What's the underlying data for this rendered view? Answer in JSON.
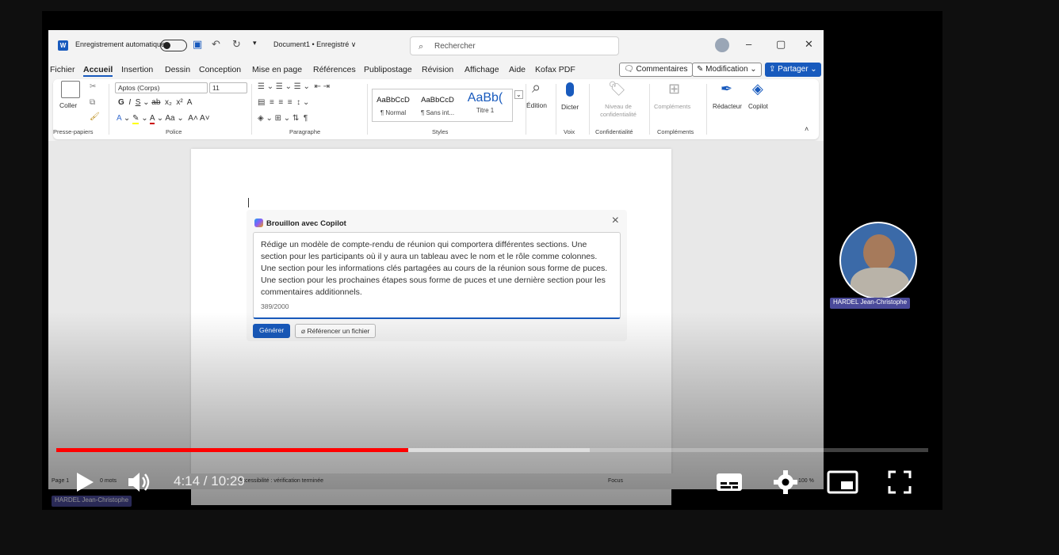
{
  "word": {
    "titlebar": {
      "autosave_label": "Enregistrement automatique",
      "doc_title": "Document1 • Enregistré ∨",
      "search_placeholder": "Rechercher"
    },
    "menu": {
      "tabs": [
        "Fichier",
        "Accueil",
        "Insertion",
        "Dessin",
        "Conception",
        "Mise en page",
        "Références",
        "Publipostage",
        "Révision",
        "Affichage",
        "Aide",
        "Kofax PDF"
      ],
      "active_tab": "Accueil",
      "comments_button": "Commentaires",
      "editing_button": "Modification",
      "share_button": "Partager"
    },
    "ribbon": {
      "paste_label": "Coller",
      "font_name": "Aptos (Corps)",
      "font_size": "11",
      "styles": [
        {
          "preview": "AaBbCcD",
          "name": "¶ Normal"
        },
        {
          "preview": "AaBbCcD",
          "name": "¶ Sans int..."
        },
        {
          "preview": "AaBb(",
          "name": "Titre 1"
        }
      ],
      "edition_label": "Édition",
      "dictate_label": "Dicter",
      "sensitivity_label": "Niveau de confidentialité",
      "addins_label": "Compléments",
      "editor_label": "Rédacteur",
      "copilot_label": "Copilot",
      "groups": {
        "clipboard": "Presse-papiers",
        "font": "Police",
        "paragraph": "Paragraphe",
        "styles": "Styles",
        "voice": "Voix",
        "sensitivity": "Confidentialité",
        "addins": "Compléments"
      }
    },
    "copilot": {
      "title": "Brouillon avec Copilot",
      "prompt": "Rédige un modèle de compte-rendu de réunion qui comportera différentes sections. Une section pour les participants où il y aura un tableau avec le nom et le rôle comme colonnes. Une section pour les informations clés partagées au cours de la réunion sous forme de puces. Une section pour les prochaines étapes sous forme de puces et une dernière section pour les commentaires additionnels.",
      "char_count": "389/2000",
      "generate_button": "Générer",
      "reference_button": "Référencer un fichier"
    },
    "statusbar": {
      "page": "Page 1",
      "words": "0 mots",
      "accessibility": "Accessibilité : vérification terminée",
      "focus": "Focus",
      "zoom": "100 %"
    }
  },
  "presenter": {
    "name": "HARDEL Jean-Christophe"
  },
  "player": {
    "current_time": "4:14",
    "duration": "10:29",
    "time_display": "4:14 / 10:29",
    "played_fraction": 0.404,
    "buffered_fraction": 0.612
  },
  "colors": {
    "accent": "#185abd",
    "progress_played": "#ff0000",
    "page_bg": "#0f0f0f"
  }
}
